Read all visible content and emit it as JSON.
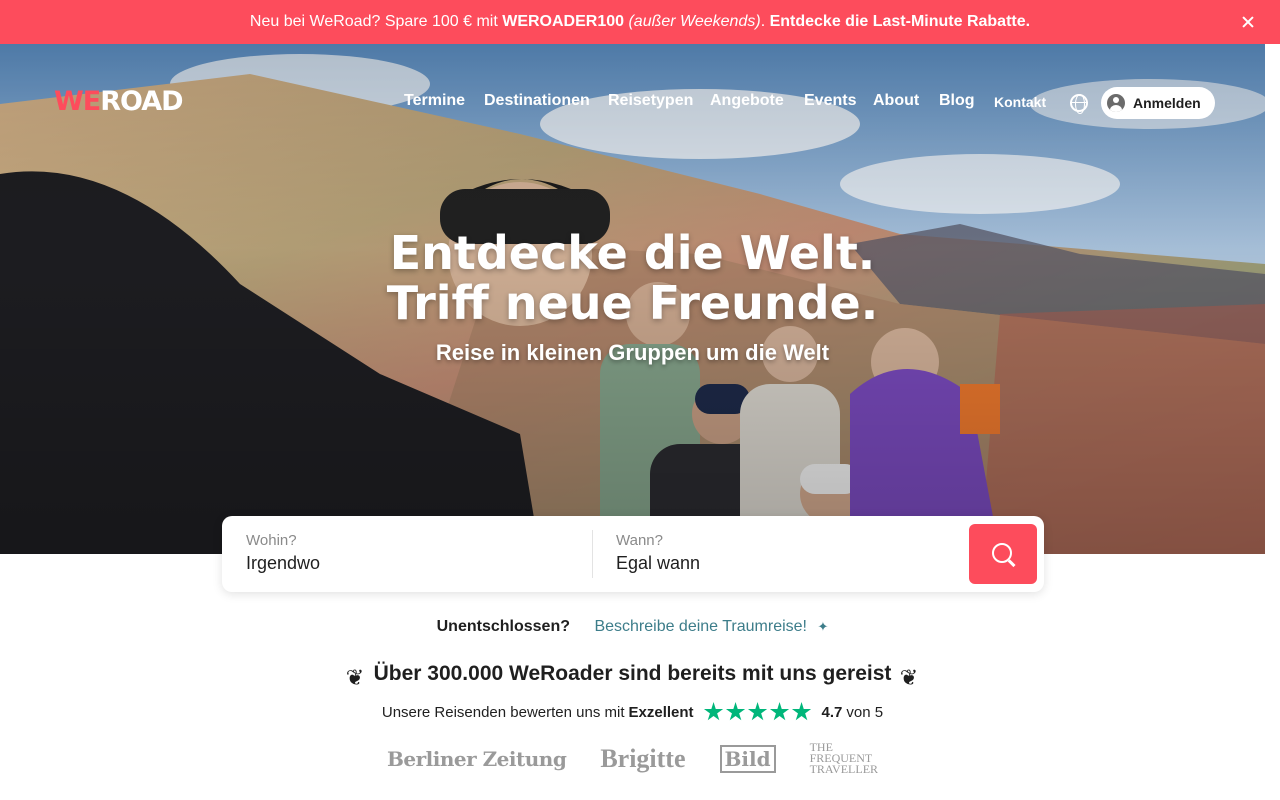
{
  "promo": {
    "part1": "Neu bei WeRoad? Spare 100 € mit ",
    "code": "WEROADER100",
    "part2": " (außer Weekends)",
    "part3": ". ",
    "cta": "Entdecke die Last-Minute Rabatte."
  },
  "logo": {
    "we": "WE",
    "road": "ROAD"
  },
  "nav": {
    "items": [
      "Termine",
      "Destinationen",
      "Reisetypen",
      "Angebote",
      "Events",
      "About",
      "Blog",
      "Kontakt"
    ],
    "login_label": "Anmelden"
  },
  "hero": {
    "headline1": "Entdecke die Welt.",
    "headline2": "Triff neue Freunde.",
    "subline": "Reise in kleinen Gruppen um die Welt"
  },
  "search": {
    "where_label": "Wohin?",
    "where_value": "Irgendwo",
    "when_label": "Wann?",
    "when_value": "Egal wann"
  },
  "undecided": {
    "question": "Unentschlossen?",
    "link": "Beschreibe deine Traumreise!"
  },
  "trust": {
    "headline": "Über 300.000 WeRoader sind bereits mit uns gereist",
    "rating_prefix": "Unsere Reisenden bewerten uns mit",
    "rating_word": "Exzellent",
    "score": "4.7",
    "score_suffix": "von 5",
    "stars": 5,
    "star_color": "#00b67a"
  },
  "press": {
    "logos": [
      "Berliner Zeitung",
      "Brigitte",
      "Bild",
      "THE",
      "FREQUENT",
      "TRAVELLER"
    ]
  },
  "colors": {
    "brand": "#fd4c5c",
    "link": "#3d7d8a"
  }
}
